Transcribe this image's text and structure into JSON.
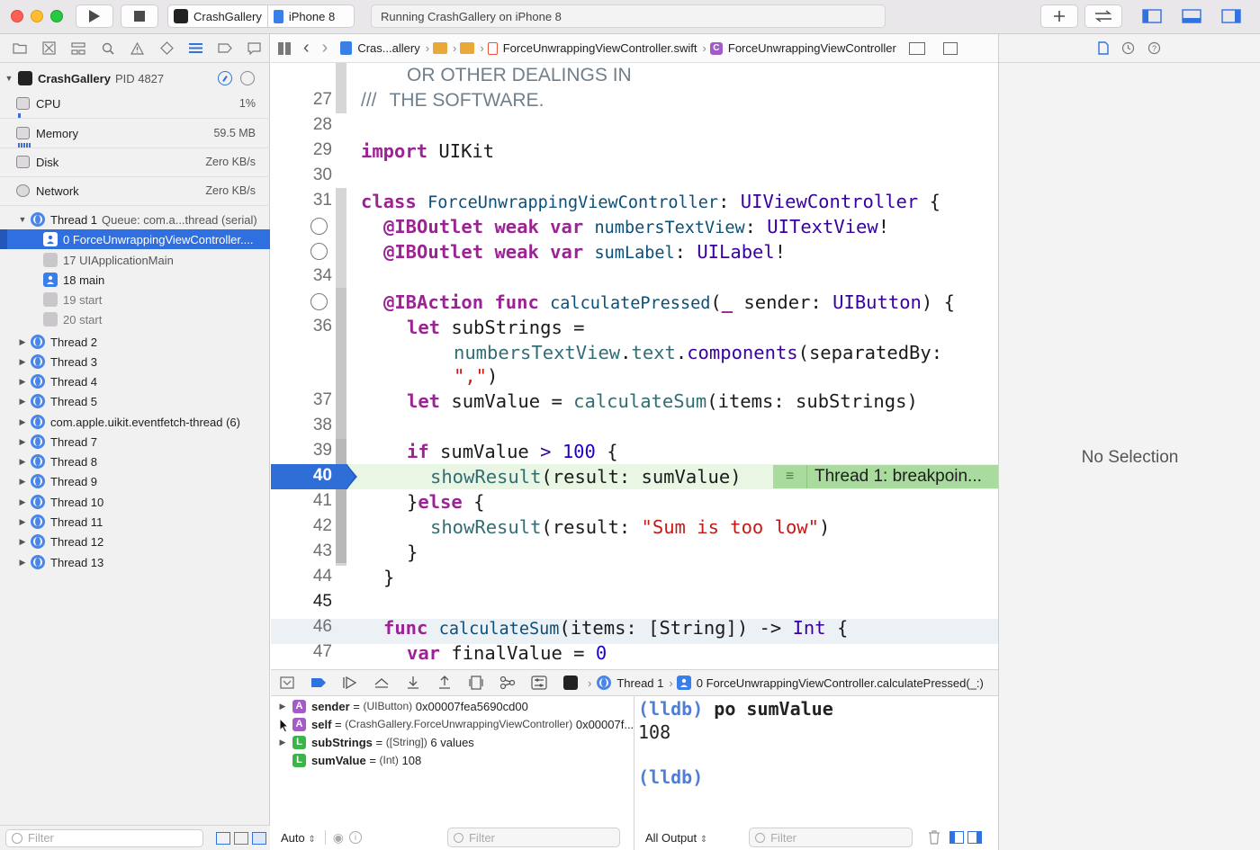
{
  "window": {
    "scheme_name": "CrashGallery",
    "device": "iPhone 8",
    "activity": "Running CrashGallery on iPhone 8"
  },
  "navigator": {
    "process": "CrashGallery",
    "pid": "PID 4827",
    "gauges": [
      {
        "label": "CPU",
        "value": "1%"
      },
      {
        "label": "Memory",
        "value": "59.5 MB"
      },
      {
        "label": "Disk",
        "value": "Zero KB/s"
      },
      {
        "label": "Network",
        "value": "Zero KB/s"
      }
    ],
    "thread1": {
      "label": "Thread 1",
      "queue": "Queue: com.a...thread (serial)"
    },
    "frames": [
      "0 ForceUnwrappingViewController....",
      "17 UIApplicationMain",
      "18 main",
      "19 start",
      "20 start"
    ],
    "threads": [
      "Thread 2",
      "Thread 3",
      "Thread 4",
      "Thread 5",
      "com.apple.uikit.eventfetch-thread (6)",
      "Thread 7",
      "Thread 8",
      "Thread 9",
      "Thread 10",
      "Thread 11",
      "Thread 12",
      "Thread 13"
    ],
    "filter_placeholder": "Filter"
  },
  "jumpbar": {
    "project": "Cras...allery",
    "file": "ForceUnwrappingViewController.swift",
    "symbol": "ForceUnwrappingViewController"
  },
  "code": {
    "line_numbers": [
      "27",
      "28",
      "29",
      "30",
      "31",
      "34",
      "36",
      "37",
      "38",
      "39",
      "40",
      "41",
      "42",
      "43",
      "44",
      "45",
      "46",
      "47"
    ],
    "l26_text": "OR OTHER DEALINGS IN",
    "l27_prefix": "///",
    "l27_text": "THE SOFTWARE.",
    "import_kw": "import",
    "import_mod": "UIKit",
    "class_kw": "class",
    "class_name": "ForceUnwrappingViewController",
    "class_super": "UIViewController",
    "open_brace": "{",
    "outlet_attr": "@IBOutlet",
    "weak_kw": "weak",
    "var_kw": "var",
    "outlet1_name": "numbersTextView",
    "outlet1_type": "UITextView",
    "outlet2_name": "sumLabel",
    "outlet2_type": "UILabel",
    "action_attr": "@IBAction",
    "func_kw": "func",
    "action_name": "calculatePressed",
    "action_param_label": "_",
    "action_param": "sender",
    "action_param_type": "UIButton",
    "let_kw": "let",
    "sub_var": "subStrings",
    "sub_expr1": "numbersTextView",
    "sub_expr2": "text",
    "sub_expr3": "components",
    "sub_expr4": "separatedBy:",
    "sub_str": "\",\"",
    "sum_var": "sumValue",
    "sum_call": "calculateSum",
    "sum_args": "items: subStrings",
    "if_kw": "if",
    "if_num": "100",
    "show_call": "showResult",
    "show_args": "result: sumValue",
    "else_kw": "else",
    "show_str": "\"Sum is too low\"",
    "calc_name": "calculateSum",
    "calc_params": "items: [String]",
    "calc_ret": "Int",
    "final_var": "finalValue",
    "final_val": "0",
    "breakpoint_label": "Thread 1: breakpoin..."
  },
  "debugbar": {
    "thread": "Thread 1",
    "frame": "0 ForceUnwrappingViewController.calculatePressed(_:)"
  },
  "variables": [
    {
      "badge": "A",
      "name": "sender",
      "type": "(UIButton)",
      "value": "0x00007fea5690cd00",
      "expandable": true
    },
    {
      "badge": "A",
      "name": "self",
      "type": "(CrashGallery.ForceUnwrappingViewController)",
      "value": "0x00007f...",
      "expandable": true
    },
    {
      "badge": "L",
      "name": "subStrings",
      "type": "([String])",
      "value": "6 values",
      "expandable": true
    },
    {
      "badge": "L",
      "name": "sumValue",
      "type": "(Int)",
      "value": "108",
      "expandable": false
    }
  ],
  "variables_footer": {
    "scope": "Auto",
    "filter_placeholder": "Filter"
  },
  "console": {
    "prompt": "(lldb)",
    "command": "po sumValue",
    "output": "108",
    "footer_output": "All Output",
    "filter_placeholder": "Filter"
  },
  "inspector": {
    "empty_text": "No Selection"
  },
  "colors": {
    "accent": "#3478f6",
    "breakpoint": "#2f6ed6",
    "pc_line": "#aadb9e",
    "local_badge": "#3bb54a",
    "arg_badge": "#a35bc8"
  }
}
